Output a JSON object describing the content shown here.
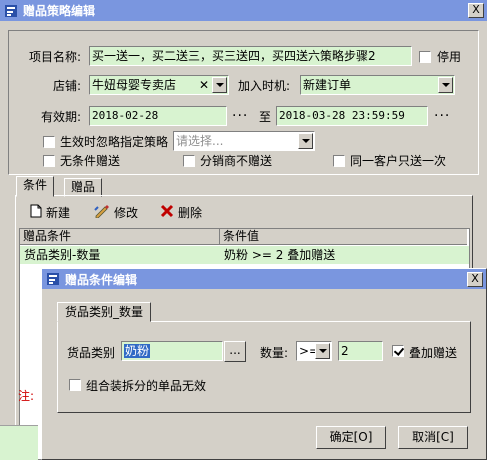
{
  "main_window": {
    "title": "赠品策略编辑",
    "close": "X",
    "project_name_label": "项目名称:",
    "project_name_value": "买一送一，买二送三，买三送四，买四送六策略步骤2",
    "disable_label": "停用",
    "disable_checked": false,
    "store_label": "店铺:",
    "store_value": "牛妞母婴专卖店",
    "store_clear": "✕",
    "join_time_label": "加入时机:",
    "join_time_value": "新建订单",
    "validity_label": "有效期:",
    "validity_from": "2018-02-28",
    "validity_to_label": "至",
    "validity_to": "2018-03-28 23:59:59",
    "ellipsis": "...",
    "ignore_strategy_label": "生效时忽略指定策略",
    "ignore_strategy_checked": false,
    "ignore_strategy_placeholder": "请选择...",
    "no_condition_label": "无条件赠送",
    "no_condition_checked": false,
    "distributor_label": "分销商不赠送",
    "distributor_checked": false,
    "same_customer_label": "同一客户只送一次",
    "same_customer_checked": false,
    "tabs": [
      "条件",
      "赠品"
    ],
    "active_tab": "条件",
    "toolbar": {
      "new_label": "新建",
      "edit_label": "修改",
      "delete_label": "删除"
    },
    "grid": {
      "columns": [
        "赠品条件",
        "条件值"
      ],
      "rows": [
        {
          "condition": "货品类别-数量",
          "value": "奶粉 >= 2 叠加赠送"
        }
      ]
    },
    "note_label": "注:"
  },
  "dialog": {
    "title": "赠品条件编辑",
    "close": "X",
    "tab_label": "货品类别_数量",
    "category_label": "货品类别",
    "category_value": "奶粉",
    "ellipsis": "...",
    "quantity_label": "数量:",
    "operator_value": ">=",
    "quantity_value": "2",
    "stack_label": "叠加赠送",
    "stack_checked": true,
    "combo_invalid_label": "组合装拆分的单品无效",
    "combo_invalid_checked": false,
    "ok_label": "确定[O]",
    "cancel_label": "取消[C]"
  },
  "colors": {
    "titlebar": "#7a96df",
    "window_bg": "#d4d0c8",
    "field_green": "#d8f3d0",
    "note_red": "#d00000"
  }
}
